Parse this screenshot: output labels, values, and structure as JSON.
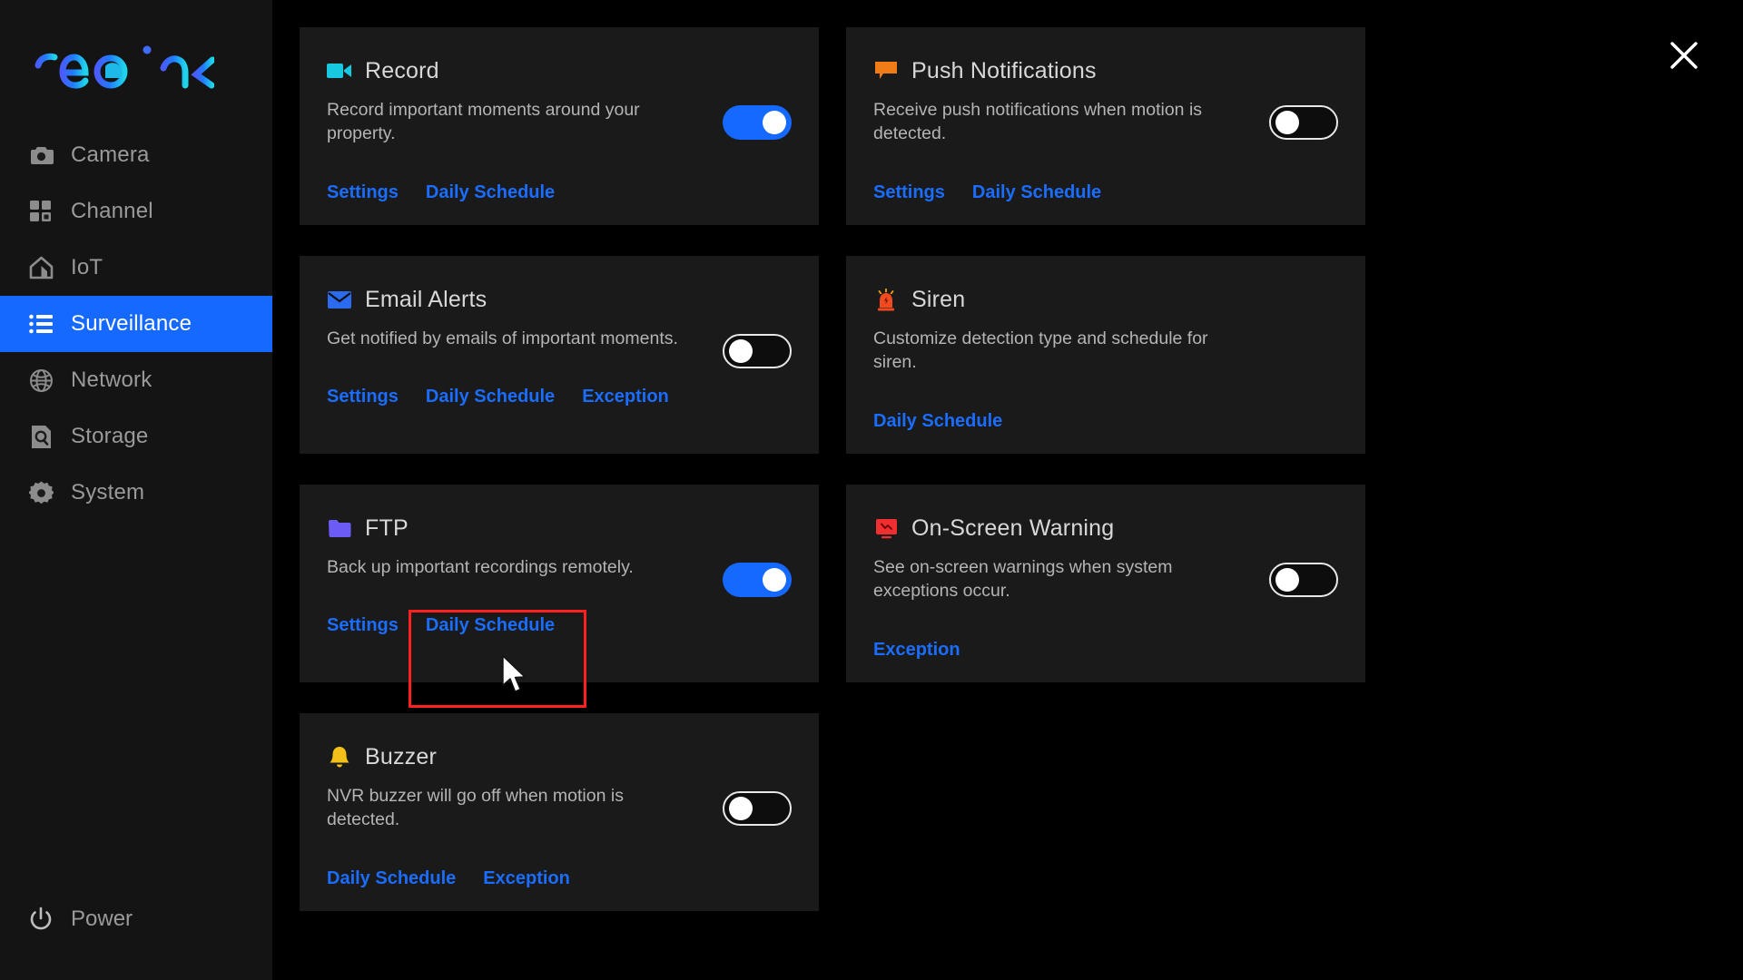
{
  "app": {
    "brand": "reolink",
    "brand_colors": {
      "start": "#4a5cff",
      "mid": "#1f7bff",
      "end": "#1fd4e8"
    }
  },
  "close_button": {
    "icon": "close-icon",
    "label": "Close"
  },
  "sidebar": {
    "items": [
      {
        "label": "Camera",
        "icon": "camera-icon",
        "active": false
      },
      {
        "label": "Channel",
        "icon": "grid-icon",
        "active": false
      },
      {
        "label": "IoT",
        "icon": "home-icon",
        "active": false
      },
      {
        "label": "Surveillance",
        "icon": "list-icon",
        "active": true
      },
      {
        "label": "Network",
        "icon": "globe-icon",
        "active": false
      },
      {
        "label": "Storage",
        "icon": "hard-drive-icon",
        "active": false
      },
      {
        "label": "System",
        "icon": "gear-icon",
        "active": false
      }
    ],
    "power": {
      "label": "Power",
      "icon": "power-icon"
    },
    "active_color": "#1569ff"
  },
  "main": {
    "cards": [
      {
        "id": "record",
        "title": "Record",
        "description": "Record important moments around your property.",
        "icon": "video-camera-icon",
        "icon_color": "#17c8e0",
        "toggle": {
          "state": "on",
          "label": "Record toggle"
        },
        "links": [
          "Settings",
          "Daily Schedule"
        ]
      },
      {
        "id": "email-alerts",
        "title": "Email Alerts",
        "description": "Get notified by emails of important moments.",
        "icon": "envelope-icon",
        "icon_color": "#2a6bf0",
        "toggle": {
          "state": "off",
          "label": "Email Alerts toggle"
        },
        "links": [
          "Settings",
          "Daily Schedule",
          "Exception"
        ]
      },
      {
        "id": "ftp",
        "title": "FTP",
        "description": "Back up important recordings remotely.",
        "icon": "folder-icon",
        "icon_color": "#6b5cf6",
        "toggle": {
          "state": "on",
          "label": "FTP toggle"
        },
        "links": [
          "Settings",
          "Daily Schedule"
        ]
      },
      {
        "id": "buzzer",
        "title": "Buzzer",
        "description": "NVR buzzer will go off when motion is detected.",
        "icon": "bell-icon",
        "icon_color": "#f2c018",
        "toggle": {
          "state": "off",
          "label": "Buzzer toggle"
        },
        "links": [
          "Daily Schedule",
          "Exception"
        ]
      },
      {
        "id": "push-notifications",
        "title": "Push Notifications",
        "description": "Receive push notifications when motion is detected.",
        "icon": "speech-bubble-icon",
        "icon_color": "#f07c18",
        "toggle": {
          "state": "off",
          "label": "Push Notifications toggle"
        },
        "links": [
          "Settings",
          "Daily Schedule"
        ]
      },
      {
        "id": "siren",
        "title": "Siren",
        "description": "Customize detection type and schedule for siren.",
        "icon": "siren-icon",
        "icon_color": "#f04a20",
        "toggle": null,
        "links": [
          "Daily Schedule"
        ]
      },
      {
        "id": "on-screen-warning",
        "title": "On-Screen Warning",
        "description": "See on-screen warnings when system exceptions occur.",
        "icon": "monitor-warning-icon",
        "icon_color": "#f03030",
        "toggle": {
          "state": "off",
          "label": "On-Screen Warning toggle"
        },
        "links": [
          "Exception"
        ]
      }
    ],
    "link_color": "#1a6dff"
  },
  "annotation": {
    "highlight": {
      "target": "FTP Daily Schedule",
      "color": "#ff2020"
    },
    "cursor": {
      "type": "arrow-pointer"
    }
  }
}
